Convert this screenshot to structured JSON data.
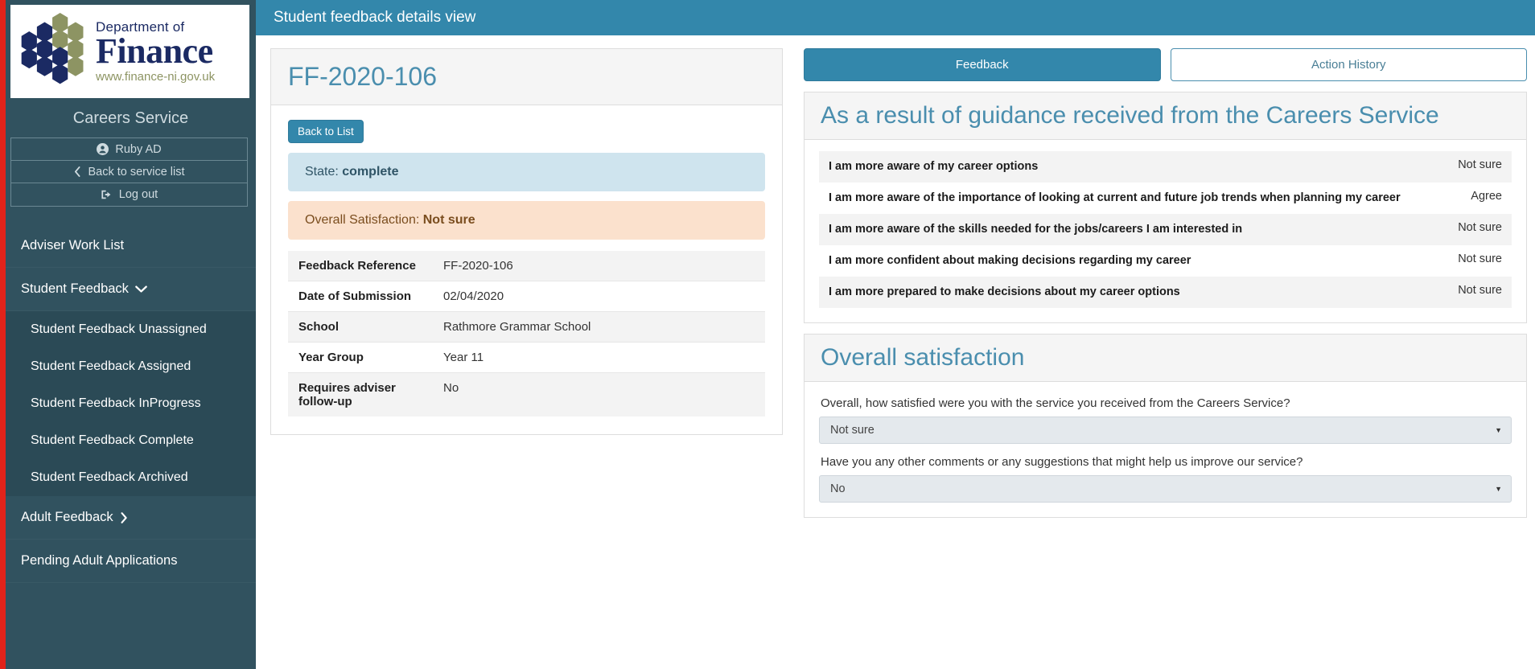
{
  "brand": {
    "department_line": "Department of",
    "name": "Finance",
    "url": "www.finance-ni.gov.uk",
    "navy": "#1b2a63",
    "olive": "#8d9463",
    "accent_red": "#e2231a"
  },
  "sidebar": {
    "service_title": "Careers Service",
    "user_buttons": [
      {
        "label": "Ruby AD",
        "icon": "user-icon"
      },
      {
        "label": "Back to service list",
        "icon": "chevron-left-icon"
      },
      {
        "label": "Log out",
        "icon": "logout-icon"
      }
    ],
    "nav": [
      {
        "label": "Adviser Work List",
        "icon": null
      },
      {
        "label": "Student Feedback",
        "icon": "chevron-down-icon"
      }
    ],
    "sub_items": [
      {
        "label": "Student Feedback Unassigned"
      },
      {
        "label": "Student Feedback Assigned"
      },
      {
        "label": "Student Feedback InProgress"
      },
      {
        "label": "Student Feedback Complete"
      },
      {
        "label": "Student Feedback Archived"
      }
    ],
    "nav_after": [
      {
        "label": "Adult Feedback",
        "icon": "chevron-right-icon"
      },
      {
        "label": "Pending Adult Applications",
        "icon": null
      }
    ],
    "bg_color": "#31525f",
    "sub_bg_color": "#2b4a56"
  },
  "topbar": {
    "title": "Student feedback details view",
    "bg_color": "#3387ab"
  },
  "left_panel": {
    "reference_title": "FF-2020-106",
    "back_button": "Back to List",
    "state_label": "State:",
    "state_value": "complete",
    "satisfaction_label": "Overall Satisfaction:",
    "satisfaction_value": "Not sure",
    "details": [
      {
        "key": "Feedback Reference",
        "value": "FF-2020-106"
      },
      {
        "key": "Date of Submission",
        "value": "02/04/2020"
      },
      {
        "key": "School",
        "value": "Rathmore Grammar School"
      },
      {
        "key": "Year Group",
        "value": "Year 11"
      },
      {
        "key": "Requires adviser follow-up",
        "value": "No"
      }
    ]
  },
  "right_panel": {
    "tabs": [
      {
        "label": "Feedback",
        "active": true
      },
      {
        "label": "Action History",
        "active": false
      }
    ],
    "guidance_section": {
      "heading": "As a result of guidance received from the Careers Service",
      "rows": [
        {
          "question": "I am more aware of my career options",
          "answer": "Not sure"
        },
        {
          "question": "I am more aware of the importance of looking at current and future job trends when planning my career",
          "answer": "Agree"
        },
        {
          "question": "I am more aware of the skills needed for the jobs/careers I am interested in",
          "answer": "Not sure"
        },
        {
          "question": "I am more confident about making decisions regarding my career",
          "answer": "Not sure"
        },
        {
          "question": "I am more prepared to make decisions about my career options",
          "answer": "Not sure"
        }
      ]
    },
    "satisfaction_section": {
      "heading": "Overall satisfaction",
      "fields": [
        {
          "label": "Overall, how satisfied were you with the service you received from the Careers Service?",
          "value": "Not sure"
        },
        {
          "label": "Have you any other comments or any suggestions that might help us improve our service?",
          "value": "No"
        }
      ]
    }
  }
}
